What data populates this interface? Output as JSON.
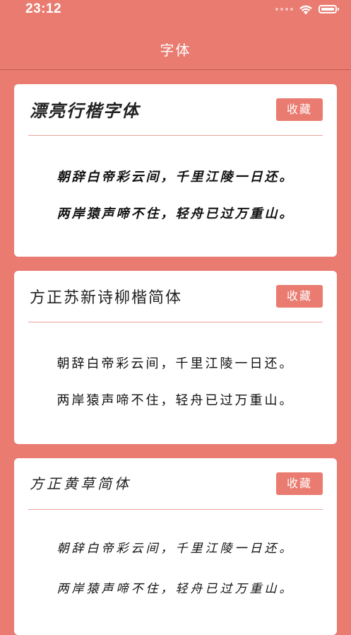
{
  "status_bar": {
    "time": "23:12"
  },
  "nav": {
    "title": "字体"
  },
  "cards": [
    {
      "title": "漂亮行楷字体",
      "fav_label": "收藏",
      "lines": [
        "朝辞白帝彩云间，千里江陵一日还。",
        "两岸猿声啼不住，轻舟已过万重山。"
      ]
    },
    {
      "title": "方正苏新诗柳楷简体",
      "fav_label": "收藏",
      "lines": [
        "朝辞白帝彩云间，千里江陵一日还。",
        "两岸猿声啼不住，轻舟已过万重山。"
      ]
    },
    {
      "title": "方正黄草简体",
      "fav_label": "收藏",
      "lines": [
        "朝辞白帝彩云间，千里江陵一日还。",
        "两岸猿声啼不住，轻舟已过万重山。"
      ]
    }
  ]
}
